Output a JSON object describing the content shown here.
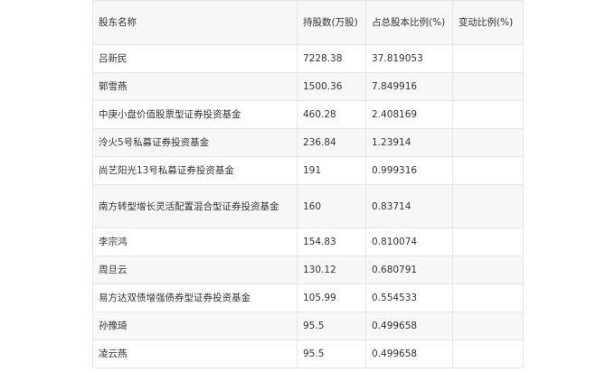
{
  "table": {
    "headers": [
      "股东名称",
      "持股数(万股)",
      "占总股本比例(%)",
      "变动比例(%)"
    ],
    "rows": [
      {
        "name": "吕新民",
        "shares": "7228.38",
        "ratio": "37.819053",
        "change": ""
      },
      {
        "name": "郭雪燕",
        "shares": "1500.36",
        "ratio": "7.849916",
        "change": ""
      },
      {
        "name": "中庚小盘价值股票型证券投资基金",
        "shares": "460.28",
        "ratio": "2.408169",
        "change": ""
      },
      {
        "name": "泠火5号私募证券投资基金",
        "shares": "236.84",
        "ratio": "1.23914",
        "change": ""
      },
      {
        "name": "尚艺阳光13号私募证券投资基金",
        "shares": "191",
        "ratio": "0.999316",
        "change": ""
      },
      {
        "name": "南方转型增长灵活配置混合型证券投资基金",
        "shares": "160",
        "ratio": "0.83714",
        "change": ""
      },
      {
        "name": "李宗鸿",
        "shares": "154.83",
        "ratio": "0.810074",
        "change": ""
      },
      {
        "name": "周旦云",
        "shares": "130.12",
        "ratio": "0.680791",
        "change": ""
      },
      {
        "name": "易方达双债增强债券型证券投资基金",
        "shares": "105.99",
        "ratio": "0.554533",
        "change": ""
      },
      {
        "name": "孙豫琦",
        "shares": "95.5",
        "ratio": "0.499658",
        "change": ""
      },
      {
        "name": "凌云燕",
        "shares": "95.5",
        "ratio": "0.499658",
        "change": ""
      }
    ]
  }
}
